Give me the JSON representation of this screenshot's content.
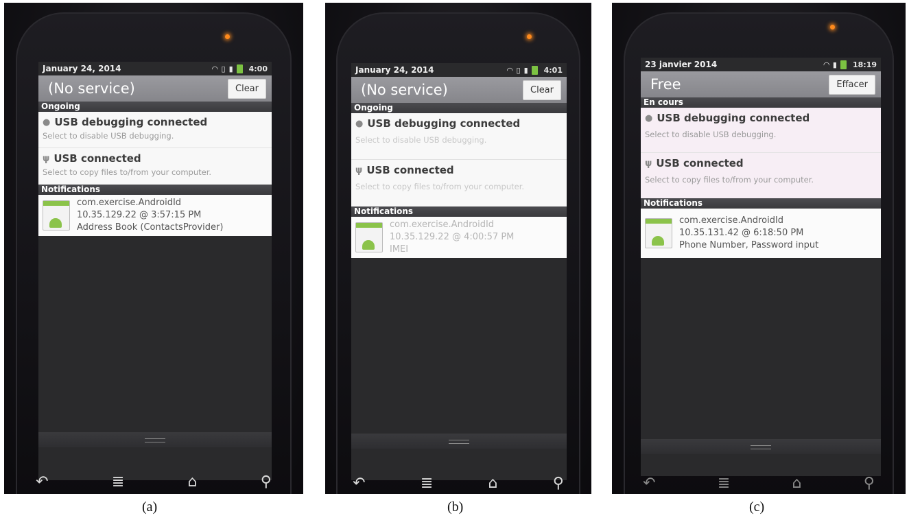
{
  "panels": [
    {
      "date": "January 24, 2014",
      "time": "4:00",
      "carrier": "(No service)",
      "clear_label": "Clear",
      "ongoing_header": "Ongoing",
      "usb_debug_title": "USB debugging connected",
      "usb_debug_sub": "Select to disable USB debugging.",
      "usb_title": "USB connected",
      "usb_sub": "Select to copy files to/from your computer.",
      "notifications_header": "Notifications",
      "notif_app": "com.exercise.AndroidId",
      "notif_ip": "10.35.129.22 @ 3:57:15 PM",
      "notif_detail": "Address Book (ContactsProvider)",
      "caption": "(a)"
    },
    {
      "date": "January 24, 2014",
      "time": "4:01",
      "carrier": "(No service)",
      "clear_label": "Clear",
      "ongoing_header": "Ongoing",
      "usb_debug_title": "USB debugging connected",
      "usb_debug_sub": "Select to disable USB debugging.",
      "usb_title": "USB connected",
      "usb_sub": "Select to copy files to/from your computer.",
      "notifications_header": "Notifications",
      "notif_app": "com.exercise.AndroidId",
      "notif_ip": "10.35.129.22 @ 4:00:57 PM",
      "notif_detail": "IMEI",
      "caption": "(b)"
    },
    {
      "date": "23 janvier 2014",
      "time": "18:19",
      "carrier": "Free",
      "clear_label": "Effacer",
      "ongoing_header": "En cours",
      "usb_debug_title": "USB debugging connected",
      "usb_debug_sub": "Select to disable USB debugging.",
      "usb_title": "USB connected",
      "usb_sub": "Select to copy files to/from your computer.",
      "notifications_header": "Notifications",
      "notif_app": "com.exercise.AndroidId",
      "notif_ip": "10.35.131.42 @ 6:18:50 PM",
      "notif_detail": "Phone Number, Password input",
      "caption": "(c)"
    }
  ],
  "icons": {
    "wifi": "wifi-icon",
    "signal": "signal-icon",
    "battery": "battery-icon",
    "android": "android-icon",
    "usb": "usb-icon",
    "back": "back-icon",
    "menu": "menu-icon",
    "home": "home-icon",
    "search": "search-icon"
  },
  "colors": {
    "carrier_bar": "#8e8e93",
    "battery": "#7cc242",
    "led": "#ff8a1c"
  }
}
